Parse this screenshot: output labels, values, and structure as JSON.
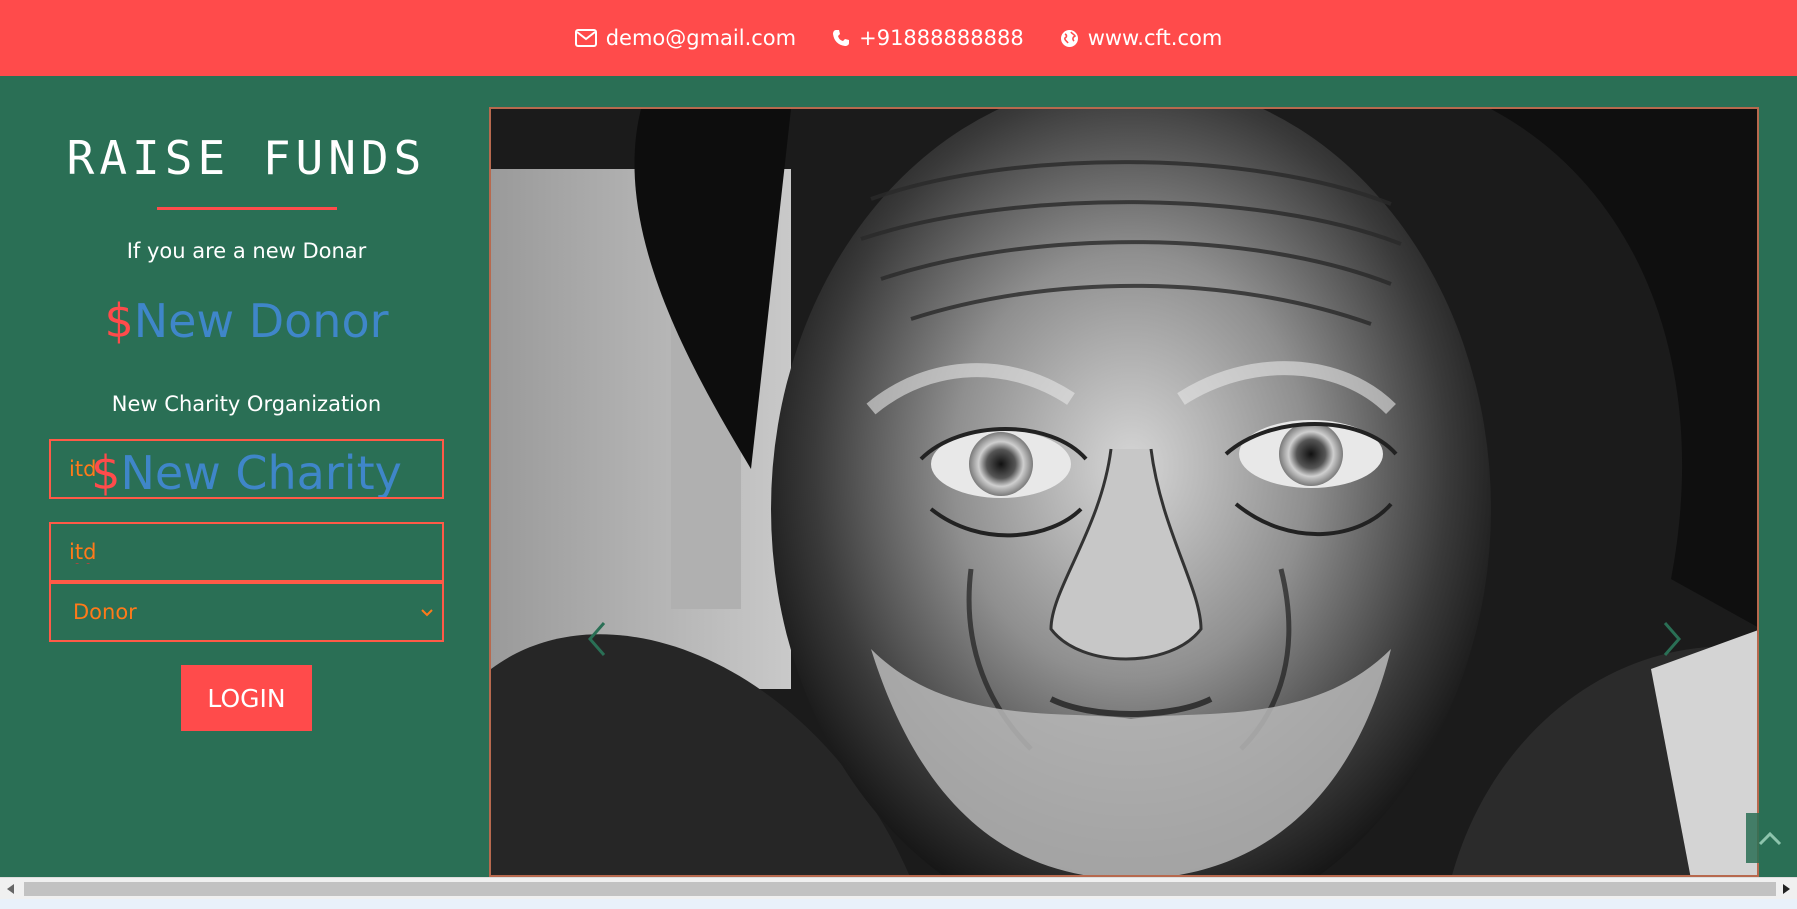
{
  "topbar": {
    "email": "demo@gmail.com",
    "phone": "+91888888888",
    "website": "www.cft.com",
    "icons": [
      "envelope-icon",
      "phone-icon",
      "globe-icon"
    ]
  },
  "sidebar": {
    "brand": "RAISE FUNDS",
    "donor_prompt": "If you are a new Donar",
    "donor_cta_symbol": "$",
    "donor_cta": "New Donor",
    "charity_prompt": "New Charity Organization",
    "charity_cta_symbol": "$",
    "charity_cta": "New Charity"
  },
  "login_form": {
    "username_value": "itd",
    "password_value": "itd",
    "role_selected": "Donor",
    "role_options": [
      "Donor"
    ],
    "submit_label": "LOGIN"
  },
  "carousel": {
    "prev_icon": "chevron-left-icon",
    "next_icon": "chevron-right-icon"
  },
  "colors": {
    "accent": "#ff4b4b",
    "background": "#2a6f55",
    "link": "#3f86c9",
    "input_text": "#ff7a1a"
  }
}
